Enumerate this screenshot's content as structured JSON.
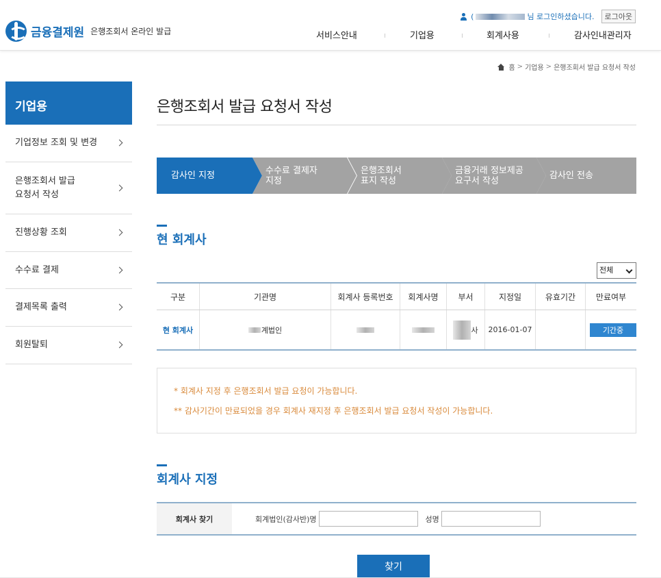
{
  "header": {
    "logo_name": "금융결제원",
    "logo_sub": "은행조회서 온라인 발급",
    "user_prefix": "(",
    "user_suffix": "님 로그인하셨습니다.",
    "logout_label": "로그아웃",
    "gnb": [
      "서비스안내",
      "기업용",
      "회계사용",
      "감사인내관리자"
    ]
  },
  "breadcrumb": [
    "홈",
    "기업용",
    "은행조회서 발급 요청서 작성"
  ],
  "sidebar": {
    "title": "기업용",
    "items": [
      {
        "label": "기업정보 조회 및 변경"
      },
      {
        "label": "은행조회서 발급\n요청서 작성"
      },
      {
        "label": "진행상황 조회"
      },
      {
        "label": "수수료 결제"
      },
      {
        "label": "결제목록 출력"
      },
      {
        "label": "회원탈퇴"
      }
    ]
  },
  "main": {
    "title": "은행조회서 발급 요청서 작성",
    "steps": [
      {
        "label": "감사인 지정",
        "active": true
      },
      {
        "label": "수수료 결제자\n지정",
        "active": false
      },
      {
        "label": "은행조회서\n표지 작성",
        "active": false
      },
      {
        "label": "금융거래 정보제공\n요구서 작성",
        "active": false
      },
      {
        "label": "감사인 전송",
        "active": false
      }
    ],
    "current_section_title": "현 회계사",
    "filter_value": "전체",
    "table": {
      "headers": [
        "구분",
        "기관명",
        "회계사 등록번호",
        "회계사명",
        "부서",
        "지정일",
        "유효기간",
        "만료여부"
      ],
      "row": {
        "type": "현 회계사",
        "org": "계법인",
        "reg_no": "",
        "name": "",
        "dept": "사",
        "date": "2016-01-07",
        "valid": "",
        "status": "기간중"
      }
    },
    "notices": [
      "* 회계사 지정 후 은행조회서 발급 요청이 가능합니다.",
      "** 감사기간이 만료되었을 경우 회계사 재지정 후 은행조회서 발급 요청서 작성이 가능합니다."
    ],
    "assign_section_title": "회계사 지정",
    "search": {
      "label": "회계사 찾기",
      "field1_label": "회계법인(감사반)명",
      "field1_value": "",
      "field2_label": "성명",
      "field2_value": "",
      "button_label": "찾기"
    }
  },
  "colors": {
    "primary": "#1a6fb8",
    "step_inactive": "#a3a3a3",
    "notice_text": "#d98a3b",
    "status_button": "#2f86d0"
  }
}
